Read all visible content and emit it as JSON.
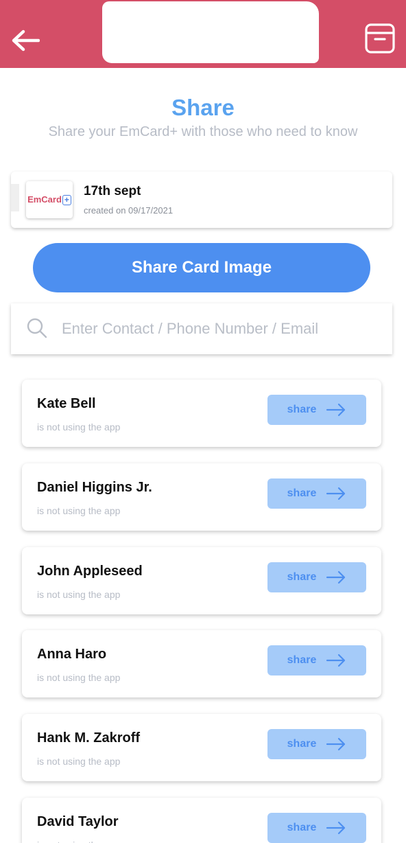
{
  "colors": {
    "header_bg": "#d44e67",
    "accent_blue": "#4d8ff0",
    "title_blue": "#5aa3ef",
    "share_btn_bg": "#a5cbf9",
    "muted_text": "#b7bcc6"
  },
  "header": {
    "back_icon": "arrow-left-icon",
    "action_icon": "archive-box-icon"
  },
  "page": {
    "title": "Share",
    "subtitle": "Share your EmCard+ with those who need to know"
  },
  "card": {
    "logo_text": "EmCard",
    "logo_plus": "+",
    "name": "17th sept",
    "created": "created on 09/17/2021"
  },
  "share_image_button": {
    "label": "Share Card Image"
  },
  "search": {
    "icon": "search-icon",
    "placeholder": "Enter Contact / Phone Number / Email",
    "value": ""
  },
  "contacts": [
    {
      "name": "Kate Bell",
      "status": "is not using the app",
      "action": "share"
    },
    {
      "name": "Daniel Higgins Jr.",
      "status": "is not using the app",
      "action": "share"
    },
    {
      "name": "John Appleseed",
      "status": "is not using the app",
      "action": "share"
    },
    {
      "name": "Anna Haro",
      "status": "is not using the app",
      "action": "share"
    },
    {
      "name": "Hank M. Zakroff",
      "status": "is not using the app",
      "action": "share"
    },
    {
      "name": "David Taylor",
      "status": "is not using the app",
      "action": "share"
    }
  ]
}
